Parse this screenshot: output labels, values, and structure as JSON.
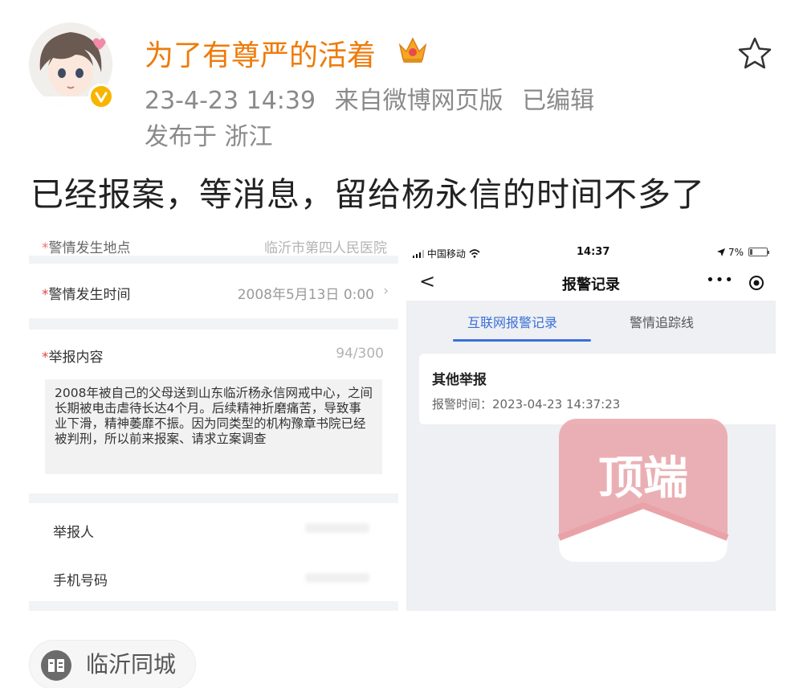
{
  "post": {
    "username": "为了有尊严的活着",
    "timestamp": "23-4-23 14:39",
    "source": "来自微博网页版",
    "edited": "已编辑",
    "location": "发布于 浙江",
    "text": "已经报案，等消息，留给杨永信的时间不多了",
    "topic": "临沂同城"
  },
  "form": {
    "location_label": "警情发生地点",
    "location_value": "临沂市第四人民医院",
    "time_label": "警情发生时间",
    "time_value": "2008年5月13日 0:00",
    "content_label": "举报内容",
    "content_count": "94/300",
    "content_text": "2008年被自己的父母送到山东临沂杨永信网戒中心，之间长期被电击虐待长达4个月。后续精神折磨痛苦，导致事业下滑，精神萎靡不振。因为同类型的机构豫章书院已经被判刑，所以前来报案、请求立案调查",
    "reporter_label": "举报人",
    "phone_label": "手机号码",
    "required_mark": "*"
  },
  "phone": {
    "carrier": "中国移动",
    "time": "14:37",
    "battery": "7%",
    "title": "报警记录",
    "back": "<",
    "more": "•••",
    "tabs": [
      {
        "label": "互联网报警记录",
        "active": true
      },
      {
        "label": "警情追踪线",
        "active": false
      }
    ],
    "record": {
      "type": "其他举报",
      "time": "报警时间：2023-04-23 14:37:23"
    }
  },
  "watermark": "顶端",
  "colors": {
    "username": "#ee7b0a",
    "accent": "#3a6fd8",
    "required": "#e84343",
    "watermark": "#e9a3a8"
  },
  "icons": [
    "verified-badge-icon",
    "crown-icon",
    "star-icon",
    "wifi-icon",
    "location-arrow-icon",
    "target-icon",
    "topic-icon"
  ]
}
